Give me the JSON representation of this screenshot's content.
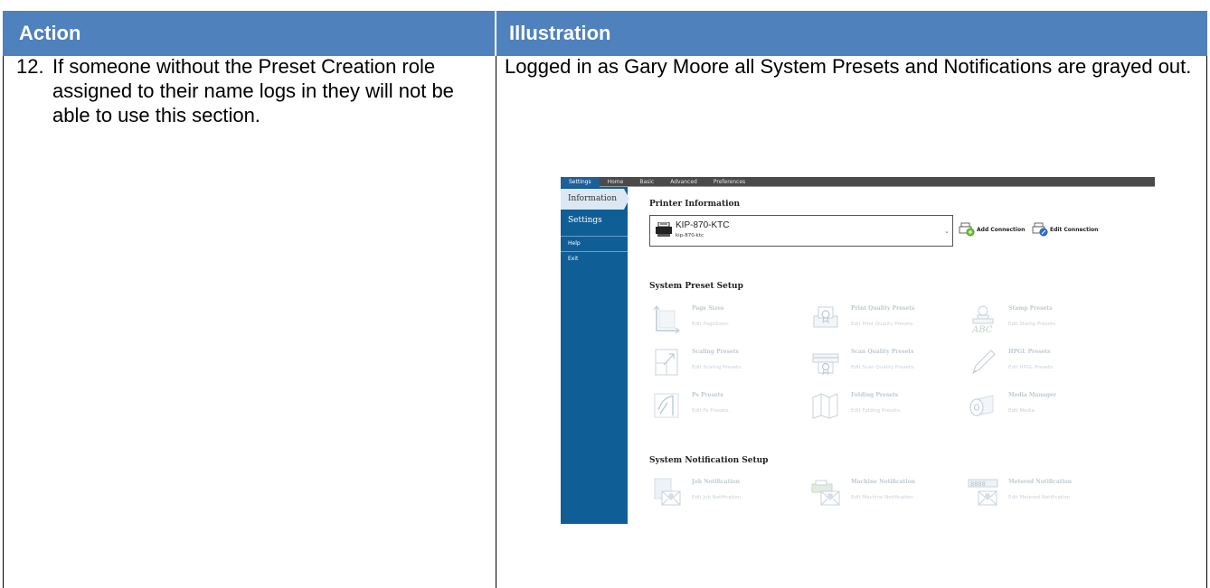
{
  "table": {
    "header_action": "Action",
    "header_illustration": "Illustration"
  },
  "step": {
    "number": "12.",
    "text": "If someone without the Preset Creation role assigned to their name logs in they will not be able to use this section."
  },
  "illustration": {
    "caption": "Logged in as Gary Moore all System Presets and Notifications are grayed out."
  },
  "app": {
    "tabs": [
      "Settings",
      "Home",
      "Basic",
      "Advanced",
      "Preferences"
    ],
    "sidebar": {
      "information": "Information",
      "settings": "Settings",
      "help": "Help",
      "exit": "Exit"
    },
    "printer_information": {
      "title": "Printer Information",
      "printer_name": "KIP-870-KTC",
      "printer_host": "kip-870-ktc",
      "add_connection": "Add Connection",
      "edit_connection": "Edit Connection"
    },
    "preset_setup": {
      "title": "System Preset Setup",
      "tiles": [
        {
          "title": "Page Sizes",
          "desc": "Edit PageSizes.",
          "icon": "page-size-icon"
        },
        {
          "title": "Print Quality Presets",
          "desc": "Edit Print Quality Presets.",
          "icon": "print-quality-icon"
        },
        {
          "title": "Stamp Presets",
          "desc": "Edit Stamp Presets.",
          "icon": "stamp-icon"
        },
        {
          "title": "Scaling Presets",
          "desc": "Edit Scaling Presets.",
          "icon": "scaling-icon"
        },
        {
          "title": "Scan Quality Presets",
          "desc": "Edit Scan Quality Presets.",
          "icon": "scan-quality-icon"
        },
        {
          "title": "HPGL Presets",
          "desc": "Edit HPGL Presets.",
          "icon": "pen-icon"
        },
        {
          "title": "Ps Presets",
          "desc": "Edit Ps Presets.",
          "icon": "ps-icon"
        },
        {
          "title": "Folding Presets",
          "desc": "Edit Folding Presets.",
          "icon": "folding-icon"
        },
        {
          "title": "Media Manager",
          "desc": "Edit Media.",
          "icon": "media-roll-icon"
        }
      ]
    },
    "notification_setup": {
      "title": "System Notification Setup",
      "tiles": [
        {
          "title": "Job Notification",
          "desc": "Edit Job Notification.",
          "icon": "job-notification-icon"
        },
        {
          "title": "Machine Notification",
          "desc": "Edit Machine Notification.",
          "icon": "machine-notification-icon"
        },
        {
          "title": "Metered Notification",
          "desc": "Edit Metered Notification.",
          "icon": "metered-notification-icon",
          "counter": "8888"
        }
      ]
    }
  }
}
